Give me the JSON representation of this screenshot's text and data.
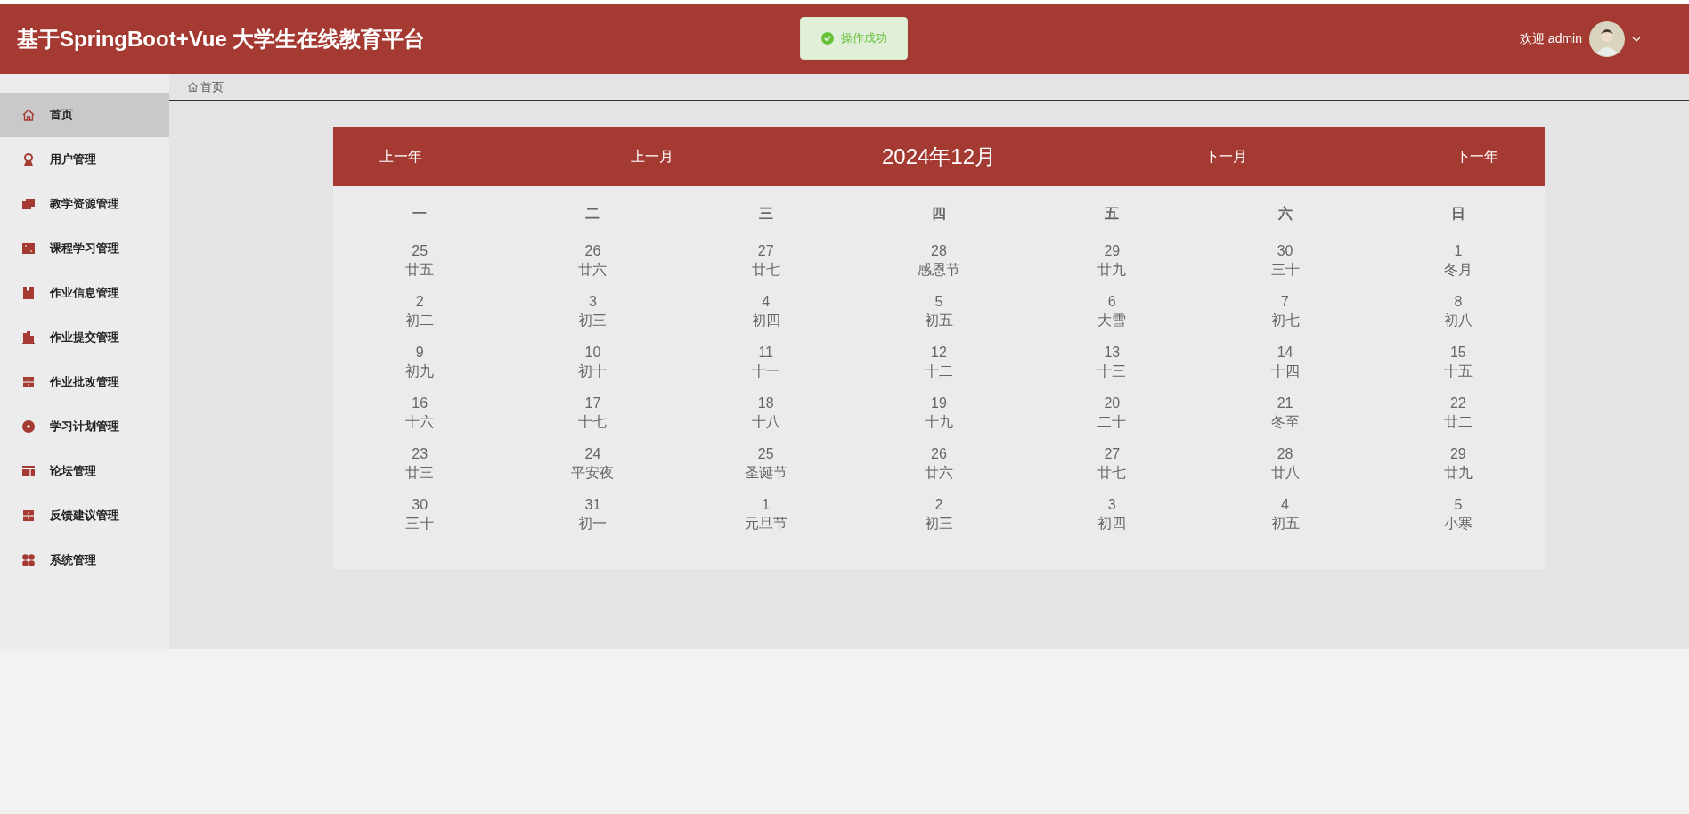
{
  "header": {
    "title": "基于SpringBoot+Vue 大学生在线教育平台",
    "welcome": "欢迎 admin"
  },
  "toast": {
    "message": "操作成功"
  },
  "sidebar": {
    "items": [
      {
        "label": "首页",
        "selected": true
      },
      {
        "label": "用户管理",
        "selected": false
      },
      {
        "label": "教学资源管理",
        "selected": false
      },
      {
        "label": "课程学习管理",
        "selected": false
      },
      {
        "label": "作业信息管理",
        "selected": false
      },
      {
        "label": "作业提交管理",
        "selected": false
      },
      {
        "label": "作业批改管理",
        "selected": false
      },
      {
        "label": "学习计划管理",
        "selected": false
      },
      {
        "label": "论坛管理",
        "selected": false
      },
      {
        "label": "反馈建议管理",
        "selected": false
      },
      {
        "label": "系统管理",
        "selected": false
      }
    ]
  },
  "breadcrumb": "首页",
  "calendar": {
    "prev_year": "上一年",
    "prev_month": "上一月",
    "title": "2024年12月",
    "next_month": "下一月",
    "next_year": "下一年",
    "weekdays": [
      "一",
      "二",
      "三",
      "四",
      "五",
      "六",
      "日"
    ],
    "weeks": [
      [
        {
          "day": "25",
          "lunar": "廿五"
        },
        {
          "day": "26",
          "lunar": "廿六"
        },
        {
          "day": "27",
          "lunar": "廿七"
        },
        {
          "day": "28",
          "lunar": "感恩节"
        },
        {
          "day": "29",
          "lunar": "廿九"
        },
        {
          "day": "30",
          "lunar": "三十"
        },
        {
          "day": "1",
          "lunar": "冬月"
        }
      ],
      [
        {
          "day": "2",
          "lunar": "初二"
        },
        {
          "day": "3",
          "lunar": "初三"
        },
        {
          "day": "4",
          "lunar": "初四"
        },
        {
          "day": "5",
          "lunar": "初五"
        },
        {
          "day": "6",
          "lunar": "大雪"
        },
        {
          "day": "7",
          "lunar": "初七"
        },
        {
          "day": "8",
          "lunar": "初八"
        }
      ],
      [
        {
          "day": "9",
          "lunar": "初九"
        },
        {
          "day": "10",
          "lunar": "初十"
        },
        {
          "day": "11",
          "lunar": "十一"
        },
        {
          "day": "12",
          "lunar": "十二"
        },
        {
          "day": "13",
          "lunar": "十三"
        },
        {
          "day": "14",
          "lunar": "十四"
        },
        {
          "day": "15",
          "lunar": "十五"
        }
      ],
      [
        {
          "day": "16",
          "lunar": "十六"
        },
        {
          "day": "17",
          "lunar": "十七"
        },
        {
          "day": "18",
          "lunar": "十八"
        },
        {
          "day": "19",
          "lunar": "十九"
        },
        {
          "day": "20",
          "lunar": "二十"
        },
        {
          "day": "21",
          "lunar": "冬至"
        },
        {
          "day": "22",
          "lunar": "廿二"
        }
      ],
      [
        {
          "day": "23",
          "lunar": "廿三"
        },
        {
          "day": "24",
          "lunar": "平安夜"
        },
        {
          "day": "25",
          "lunar": "圣诞节"
        },
        {
          "day": "26",
          "lunar": "廿六"
        },
        {
          "day": "27",
          "lunar": "廿七"
        },
        {
          "day": "28",
          "lunar": "廿八"
        },
        {
          "day": "29",
          "lunar": "廿九"
        }
      ],
      [
        {
          "day": "30",
          "lunar": "三十"
        },
        {
          "day": "31",
          "lunar": "初一"
        },
        {
          "day": "1",
          "lunar": "元旦节"
        },
        {
          "day": "2",
          "lunar": "初三"
        },
        {
          "day": "3",
          "lunar": "初四"
        },
        {
          "day": "4",
          "lunar": "初五"
        },
        {
          "day": "5",
          "lunar": "小寒"
        }
      ]
    ]
  }
}
